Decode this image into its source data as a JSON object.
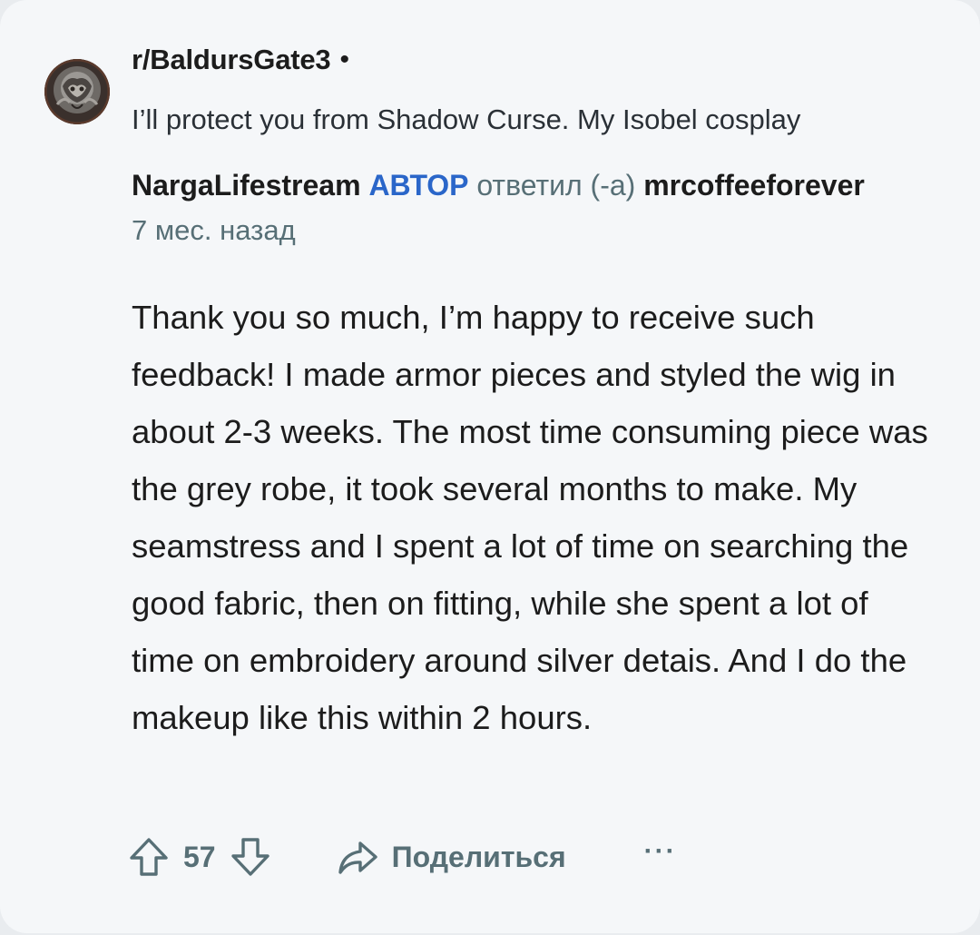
{
  "subreddit": {
    "name": "r/BaldursGate3",
    "separator": "•"
  },
  "post": {
    "title": "I’ll protect you from Shadow Curse. My Isobel cosplay"
  },
  "comment": {
    "author": "NargaLifestream",
    "author_badge": "АВТОР",
    "replied_text": "ответил (-а)",
    "replied_to": "mrcoffeeforever",
    "time_ago": "7 мес. назад",
    "body": "Thank you so much, I’m happy to receive such feedback! I made armor pieces and styled the wig in about 2-3 weeks. The most time consuming piece was the grey robe, it took several months to make. My seamstress and I spent a lot of time on searching the good fabric, then on fitting, while she spent a lot of time on embroidery around silver detais. And I do the makeup like this within 2 hours."
  },
  "actions": {
    "upvote_icon": "arrow-up-icon",
    "vote_count": "57",
    "downvote_icon": "arrow-down-icon",
    "share_icon": "share-arrow-icon",
    "share_label": "Поделиться",
    "more_label": "···"
  },
  "colors": {
    "background": "#f5f7f9",
    "text_primary": "#1c1c1c",
    "text_secondary": "#576f76",
    "author_badge": "#2a66c9"
  }
}
